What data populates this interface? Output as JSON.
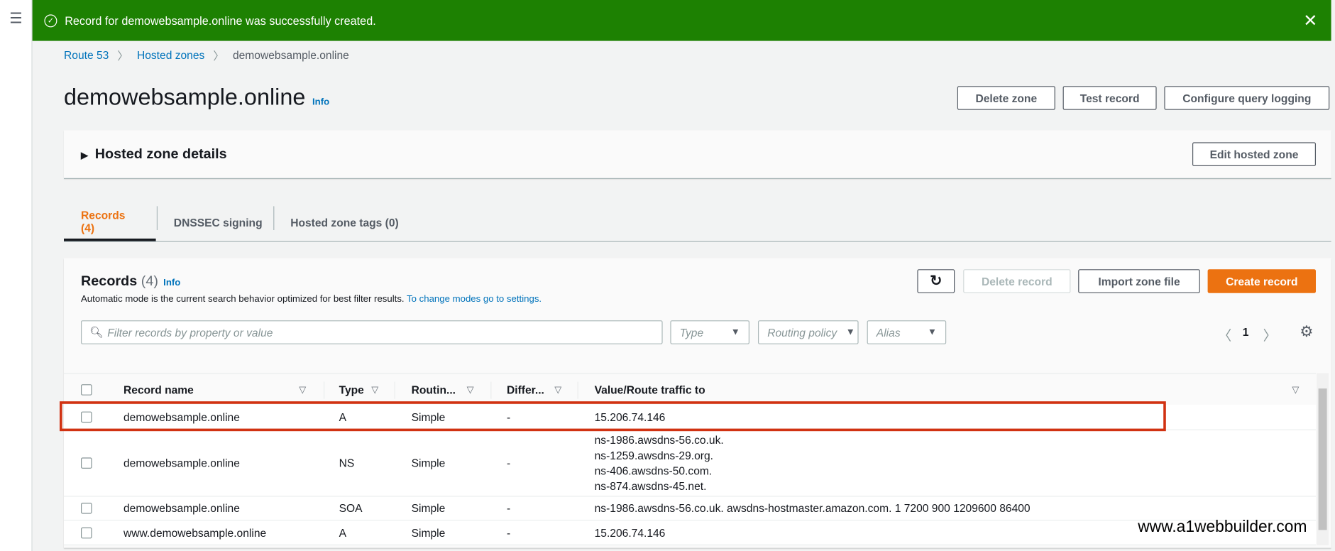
{
  "banner": {
    "message": "Record for demowebsample.online was successfully created.",
    "close": "✕",
    "icon": "check-circle-icon"
  },
  "breadcrumb": [
    "Route 53",
    "Hosted zones",
    "demowebsample.online"
  ],
  "header": {
    "title": "demowebsample.online",
    "info": "Info",
    "buttons": {
      "delete_zone": "Delete zone",
      "test_record": "Test record",
      "configure_logging": "Configure query logging"
    }
  },
  "hosted_zone_details": {
    "title": "Hosted zone details",
    "edit": "Edit hosted zone"
  },
  "tabs": [
    "Records (4)",
    "DNSSEC signing",
    "Hosted zone tags (0)"
  ],
  "records": {
    "title": "Records",
    "count": "(4)",
    "info": "Info",
    "subtitle": "Automatic mode is the current search behavior optimized for best filter results.",
    "subtitle_link": "To change modes go to settings.",
    "buttons": {
      "delete": "Delete record",
      "import": "Import zone file",
      "create": "Create record"
    },
    "filter_placeholder": "Filter records by property or value",
    "filters": [
      "Type",
      "Routing policy",
      "Alias"
    ],
    "page": "1",
    "columns": [
      "Record name",
      "Type",
      "Routin...",
      "Differ...",
      "Value/Route traffic to"
    ],
    "rows": [
      {
        "name": "demowebsample.online",
        "type": "A",
        "routing": "Simple",
        "diff": "-",
        "value": [
          "15.206.74.146"
        ]
      },
      {
        "name": "demowebsample.online",
        "type": "NS",
        "routing": "Simple",
        "diff": "-",
        "value": [
          "ns-1986.awsdns-56.co.uk.",
          "ns-1259.awsdns-29.org.",
          "ns-406.awsdns-50.com.",
          "ns-874.awsdns-45.net."
        ]
      },
      {
        "name": "demowebsample.online",
        "type": "SOA",
        "routing": "Simple",
        "diff": "-",
        "value": [
          "ns-1986.awsdns-56.co.uk. awsdns-hostmaster.amazon.com. 1 7200 900 1209600 86400"
        ]
      },
      {
        "name": "www.demowebsample.online",
        "type": "A",
        "routing": "Simple",
        "diff": "-",
        "value": [
          "15.206.74.146"
        ]
      }
    ]
  },
  "watermark": "www.a1webbuilder.com",
  "colors": {
    "success": "#1d8102",
    "primary": "#ec7211",
    "link": "#0073bb",
    "highlight": "#d13212"
  }
}
